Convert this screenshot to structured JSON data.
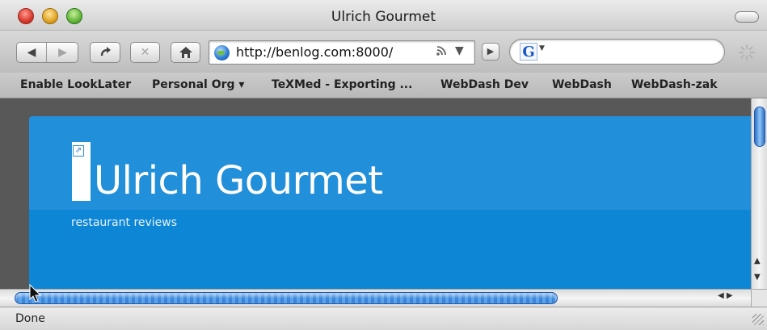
{
  "window": {
    "title": "Ulrich Gourmet"
  },
  "toolbar": {
    "back_icon": "back-arrow",
    "forward_icon": "forward-arrow",
    "reload_icon": "reload-arrow",
    "stop_icon": "stop-x",
    "home_icon": "house",
    "address": "http://benlog.com:8000/",
    "rss_icon": "rss",
    "search_engine_letter": "G",
    "search_value": ""
  },
  "bookmarks": [
    {
      "label": "Enable LookLater"
    },
    {
      "label": "Personal Org ▾"
    },
    {
      "label": "TeXMed - Exporting ..."
    },
    {
      "label": "WebDash Dev"
    },
    {
      "label": "WebDash"
    },
    {
      "label": "WebDash-zak"
    }
  ],
  "page": {
    "site_title": "Ulrich Gourmet",
    "tagline": "restaurant reviews"
  },
  "status": {
    "text": "Done"
  },
  "colors": {
    "banner_top": "#218fd9",
    "banner_bottom": "#0d86d6",
    "page_background": "#585858"
  }
}
